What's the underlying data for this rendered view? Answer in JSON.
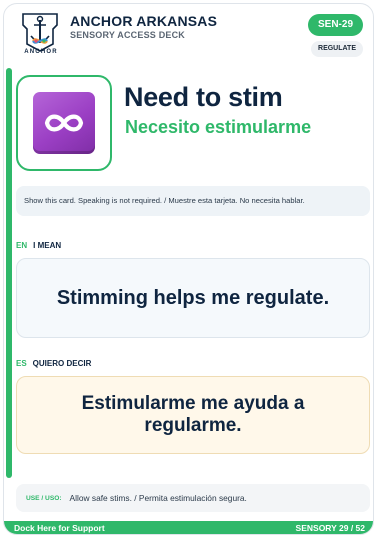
{
  "header": {
    "brand_title": "ANCHOR ARKANSAS",
    "brand_subtitle": "SENSORY ACCESS DECK",
    "logo_word": "ANCHOR",
    "card_code": "SEN-29",
    "category_tag": "REGULATE"
  },
  "hero": {
    "icon": "infinity-icon",
    "title_en": "Need to stim",
    "title_es": "Necesito estimularme"
  },
  "instruction": "Show this card. Speaking is not required. / Muestre esta tarjeta. No necesita hablar.",
  "section_en": {
    "lang": "EN",
    "label": "I MEAN",
    "text": "Stimming helps me regulate."
  },
  "section_es": {
    "lang": "ES",
    "label": "QUIERO DECIR",
    "text": "Estimularme me ayuda a regularme."
  },
  "use": {
    "label": "USE / USO:",
    "text": "Allow safe stims. / Permita estimulación segura."
  },
  "footer": {
    "left": "Dock Here for Support",
    "right": "SENSORY 29 / 52"
  },
  "colors": {
    "accent": "#2fb86a",
    "navy": "#0f2540",
    "icon_tile": "#9b3fc4"
  }
}
